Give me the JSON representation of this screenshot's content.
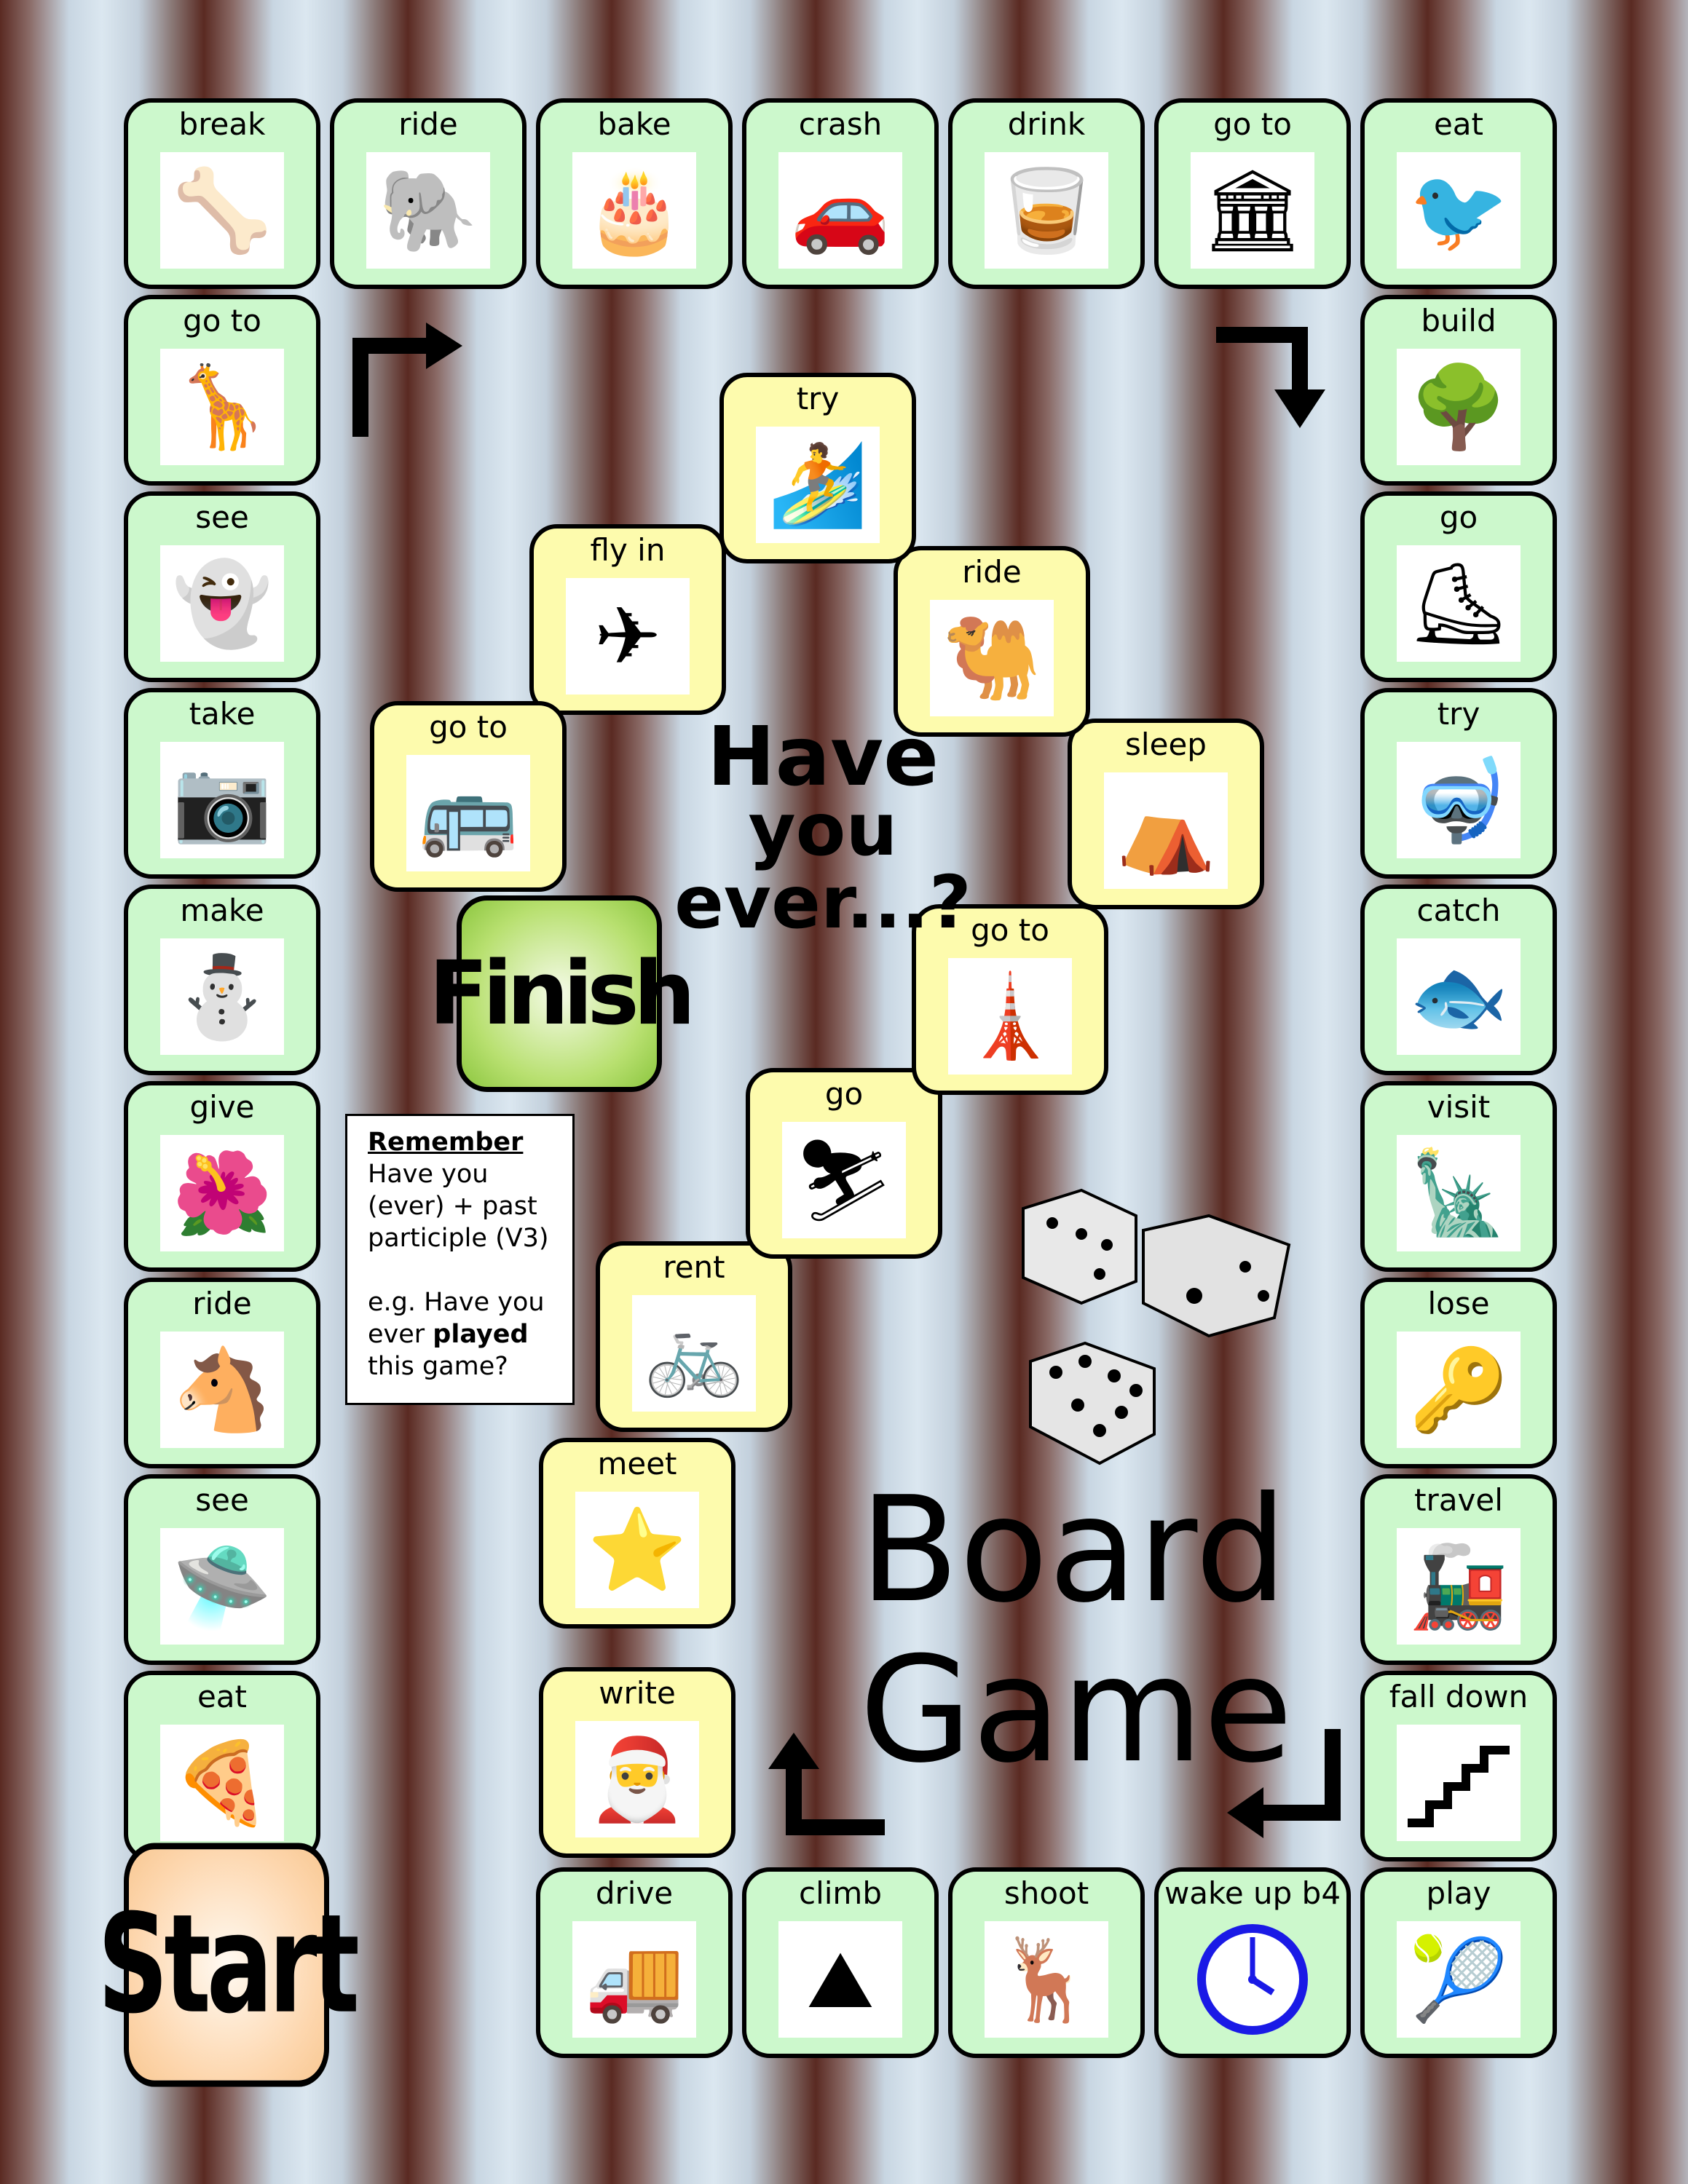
{
  "title": {
    "line1": "Have",
    "line2": "you ever...?",
    "board": "Board",
    "game": "Game"
  },
  "start_label": "Start",
  "finish_label": "Finish",
  "remember": {
    "heading": "Remember",
    "rule_lines": [
      "Have you",
      "(ever) + past",
      "participle (V3)"
    ],
    "example_prefix": "e.g. Have you",
    "example_mid": "ever ",
    "example_bold": "played",
    "example_suffix": "this game?"
  },
  "path": {
    "left_column_bottom_to_top": [
      {
        "label": "eat",
        "icon": "pizza-icon",
        "glyph": "🍕"
      },
      {
        "label": "see",
        "icon": "ufo-alien-icon",
        "glyph": "🛸"
      },
      {
        "label": "ride",
        "icon": "horse-icon",
        "glyph": "🐴"
      },
      {
        "label": "give",
        "icon": "flowers-icon",
        "glyph": "🌺"
      },
      {
        "label": "make",
        "icon": "snowman-icon",
        "glyph": "⛄"
      },
      {
        "label": "take",
        "icon": "camera-icon",
        "glyph": "📷"
      },
      {
        "label": "see",
        "icon": "ghost-icon",
        "glyph": "👻"
      },
      {
        "label": "go to",
        "icon": "zoo-animals-icon",
        "glyph": "🦒"
      }
    ],
    "top_row_left_to_right": [
      {
        "label": "break",
        "icon": "bone-icon",
        "glyph": "🦴"
      },
      {
        "label": "ride",
        "icon": "elephant-icon",
        "glyph": "🐘"
      },
      {
        "label": "bake",
        "icon": "birthday-cake-icon",
        "glyph": "🎂"
      },
      {
        "label": "crash",
        "icon": "red-car-icon",
        "glyph": "🚗"
      },
      {
        "label": "drink",
        "icon": "whisky-glass-icon",
        "glyph": "🥃"
      },
      {
        "label": "go to",
        "icon": "colosseum-icon",
        "glyph": "🏛"
      },
      {
        "label": "eat",
        "icon": "ostrich-icon",
        "glyph": "🐦"
      }
    ],
    "right_column_top_to_bottom": [
      {
        "label": "build",
        "icon": "treehouse-icon",
        "glyph": "🌳"
      },
      {
        "label": "go",
        "icon": "roller-skating-icon",
        "glyph": "⛸"
      },
      {
        "label": "try",
        "icon": "scuba-diving-icon",
        "glyph": "🤿"
      },
      {
        "label": "catch",
        "icon": "fish-icon",
        "glyph": "🐟"
      },
      {
        "label": "visit",
        "icon": "statue-of-liberty-icon",
        "glyph": "🗽"
      },
      {
        "label": "lose",
        "icon": "keys-icon",
        "glyph": "🔑"
      },
      {
        "label": "travel",
        "icon": "train-icon",
        "glyph": "🚂"
      },
      {
        "label": "fall down",
        "icon": "stairs-icon",
        "glyph": "⬆"
      }
    ],
    "bottom_row_right_to_left": [
      {
        "label": "play",
        "icon": "tennis-racket-icon",
        "glyph": "🎾"
      },
      {
        "label": "wake up b4",
        "icon": "clock-icon",
        "glyph": "🕓"
      },
      {
        "label": "shoot",
        "icon": "deer-icon",
        "glyph": "🦌"
      },
      {
        "label": "climb",
        "icon": "mountain-icon",
        "glyph": "⛰"
      },
      {
        "label": "drive",
        "icon": "truck-icon",
        "glyph": "🚚"
      }
    ],
    "inner_path": [
      {
        "label": "write",
        "icon": "santa-icon",
        "glyph": "🎅"
      },
      {
        "label": "meet",
        "icon": "star-icon",
        "glyph": "⭐"
      },
      {
        "label": "rent",
        "icon": "bicycle-icon",
        "glyph": "🚲"
      },
      {
        "label": "go",
        "icon": "skiing-icon",
        "glyph": "⛷"
      },
      {
        "label": "go to",
        "icon": "eiffel-tower-icon",
        "glyph": "🗼"
      },
      {
        "label": "sleep",
        "icon": "tent-icon",
        "glyph": "⛺"
      },
      {
        "label": "ride",
        "icon": "camel-icon",
        "glyph": "🐫"
      },
      {
        "label": "try",
        "icon": "windsurfing-icon",
        "glyph": "🏄"
      },
      {
        "label": "fly in",
        "icon": "airplane-icon",
        "glyph": "✈"
      },
      {
        "label": "go to",
        "icon": "london-bus-icon",
        "glyph": "🚌"
      }
    ]
  }
}
